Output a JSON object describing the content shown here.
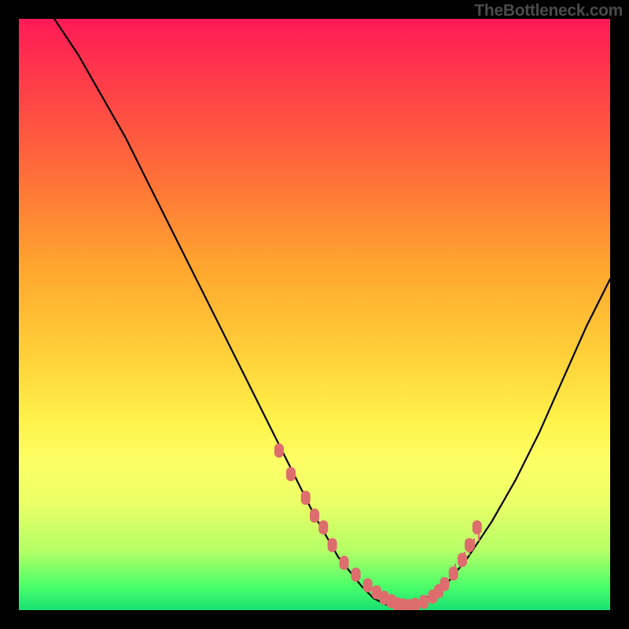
{
  "attribution": "TheBottleneck.com",
  "chart_data": {
    "type": "line",
    "title": "",
    "xlabel": "",
    "ylabel": "",
    "xlim": [
      0,
      100
    ],
    "ylim": [
      0,
      100
    ],
    "series": [
      {
        "name": "bottleneck-curve",
        "x": [
          6,
          10,
          14,
          18,
          22,
          26,
          30,
          34,
          38,
          42,
          46,
          50,
          54,
          58,
          60,
          62,
          64,
          66,
          68,
          72,
          76,
          80,
          84,
          88,
          92,
          96,
          100
        ],
        "values": [
          100,
          94,
          87,
          80,
          72,
          64,
          56,
          48,
          40,
          32,
          24,
          16,
          9,
          4,
          2,
          1,
          0.6,
          0.7,
          1.5,
          4,
          9,
          15,
          22,
          30,
          39,
          48,
          56
        ]
      }
    ],
    "markers": {
      "name": "optimal-range-points",
      "x": [
        44,
        46,
        48.5,
        50,
        51.5,
        53,
        55,
        57,
        59,
        60.5,
        61.8,
        63,
        64,
        65,
        66,
        67,
        68.5,
        70,
        71,
        72,
        73.5,
        75,
        76.2,
        77.5
      ],
      "values": [
        27,
        23,
        19,
        16,
        14,
        11,
        8,
        6,
        4.2,
        3,
        2.1,
        1.5,
        1.0,
        0.8,
        0.7,
        0.9,
        1.4,
        2.3,
        3.2,
        4.4,
        6.2,
        8.5,
        11,
        14
      ]
    },
    "ticks": {
      "x": [
        73,
        73.8,
        74.6,
        75.4,
        76.2,
        77,
        77.8
      ],
      "heights": [
        3,
        4,
        5,
        4,
        3,
        4,
        3
      ]
    }
  }
}
